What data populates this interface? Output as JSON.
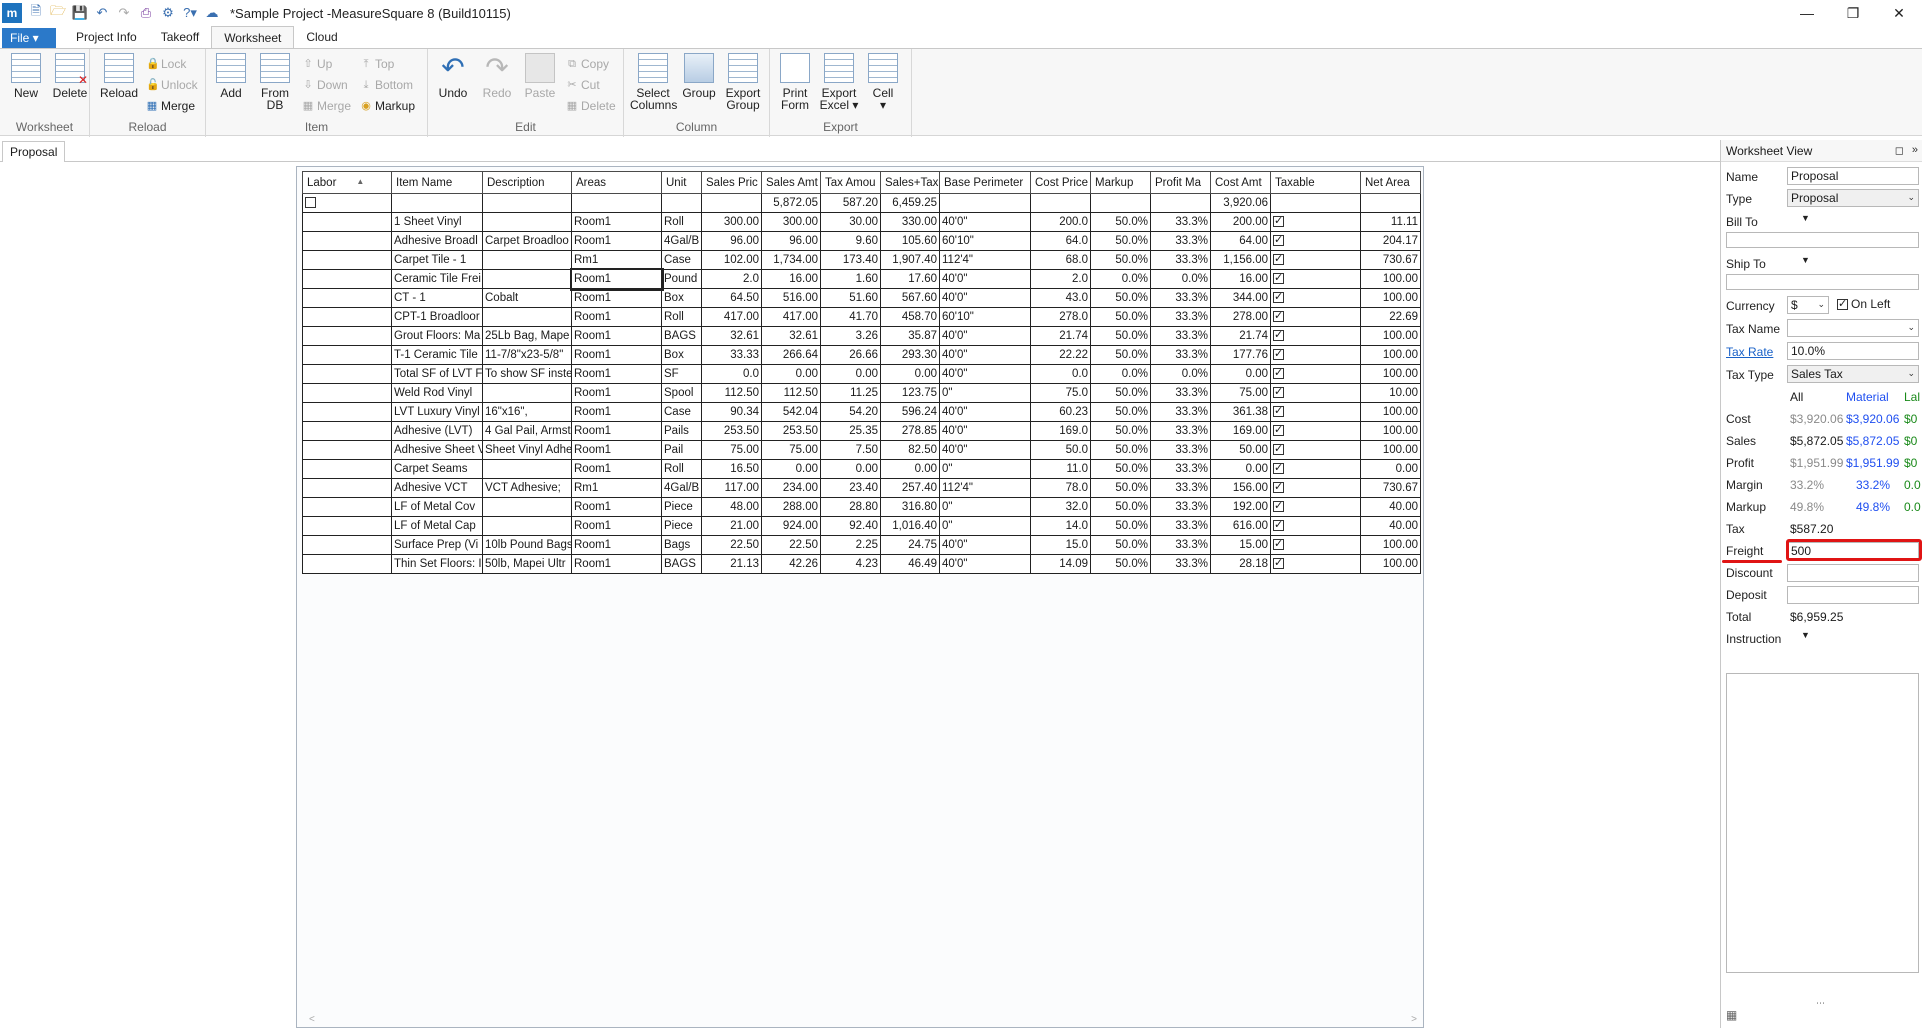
{
  "window": {
    "title": "*Sample Project -MeasureSquare 8 (Build10115)",
    "logo": "m"
  },
  "menu": {
    "file": "File",
    "tabs": [
      "Project Info",
      "Takeoff",
      "Worksheet",
      "Cloud"
    ],
    "active_tab": "Worksheet"
  },
  "ribbon": {
    "worksheet_group": {
      "label": "Worksheet",
      "new": "New",
      "delete": "Delete"
    },
    "reload_group": {
      "label": "Reload",
      "reload": "Reload",
      "lock": "Lock",
      "unlock": "Unlock",
      "merge": "Merge"
    },
    "item_group": {
      "label": "Item",
      "add": "Add",
      "from_db_1": "From",
      "from_db_2": "DB",
      "up": "Up",
      "down": "Down",
      "merge": "Merge",
      "top": "Top",
      "bottom": "Bottom",
      "markup": "Markup"
    },
    "edit_group": {
      "label": "Edit",
      "undo": "Undo",
      "redo": "Redo",
      "paste": "Paste",
      "copy": "Copy",
      "cut": "Cut",
      "delete": "Delete"
    },
    "column_group": {
      "label": "Column",
      "select_1": "Select",
      "select_2": "Columns",
      "group": "Group",
      "export_group_1": "Export",
      "export_group_2": "Group"
    },
    "export_group": {
      "label": "Export",
      "print_1": "Print",
      "print_2": "Form",
      "excel_1": "Export",
      "excel_2": "Excel",
      "cell": "Cell"
    }
  },
  "doc_tab": "Proposal",
  "grid": {
    "headers": [
      "Labor",
      "Item Name",
      "Description",
      "Areas",
      "Unit",
      "Sales Pric",
      "Sales Amt",
      "Tax Amou",
      "Sales+Tax",
      "Base Perimeter",
      "Cost Price",
      "Markup",
      "Profit Ma",
      "Cost Amt",
      "Taxable",
      "Net Area"
    ],
    "totals": {
      "sales_amt": "5,872.05",
      "tax_amt": "587.20",
      "sales_tax": "6,459.25",
      "cost_amt": "3,920.06"
    },
    "rows": [
      [
        "",
        "1 Sheet Vinyl",
        "",
        "Room1",
        "Roll",
        "300.00",
        "300.00",
        "30.00",
        "330.00",
        "40'0\"",
        "200.0",
        "50.0%",
        "33.3%",
        "200.00",
        "✓",
        "11.11"
      ],
      [
        "",
        "Adhesive Broadl",
        "Carpet Broadloo",
        "Room1",
        "4Gal/B",
        "96.00",
        "96.00",
        "9.60",
        "105.60",
        "60'10\"",
        "64.0",
        "50.0%",
        "33.3%",
        "64.00",
        "✓",
        "204.17"
      ],
      [
        "",
        "Carpet Tile - 1",
        "",
        "Rm1",
        "Case",
        "102.00",
        "1,734.00",
        "173.40",
        "1,907.40",
        "112'4\"",
        "68.0",
        "50.0%",
        "33.3%",
        "1,156.00",
        "✓",
        "730.67"
      ],
      [
        "",
        "Ceramic Tile Frei",
        "",
        "Room1",
        "Pound",
        "2.0",
        "16.00",
        "1.60",
        "17.60",
        "40'0\"",
        "2.0",
        "0.0%",
        "0.0%",
        "16.00",
        "✓",
        "100.00"
      ],
      [
        "",
        "CT - 1",
        "Cobalt",
        "Room1",
        "Box",
        "64.50",
        "516.00",
        "51.60",
        "567.60",
        "40'0\"",
        "43.0",
        "50.0%",
        "33.3%",
        "344.00",
        "✓",
        "100.00"
      ],
      [
        "",
        "CPT-1 Broadloor",
        "",
        "Room1",
        "Roll",
        "417.00",
        "417.00",
        "41.70",
        "458.70",
        "60'10\"",
        "278.0",
        "50.0%",
        "33.3%",
        "278.00",
        "✓",
        "22.69"
      ],
      [
        "",
        "Grout Floors: Ma",
        "25Lb Bag, Mape",
        "Room1",
        "BAGS",
        "32.61",
        "32.61",
        "3.26",
        "35.87",
        "40'0\"",
        "21.74",
        "50.0%",
        "33.3%",
        "21.74",
        "✓",
        "100.00"
      ],
      [
        "",
        "T-1 Ceramic Tile",
        "11-7/8\"x23-5/8\"",
        "Room1",
        "Box",
        "33.33",
        "266.64",
        "26.66",
        "293.30",
        "40'0\"",
        "22.22",
        "50.0%",
        "33.3%",
        "177.76",
        "✓",
        "100.00"
      ],
      [
        "",
        "Total SF of LVT F",
        "To show SF inste",
        "Room1",
        "SF",
        "0.0",
        "0.00",
        "0.00",
        "0.00",
        "40'0\"",
        "0.0",
        "0.0%",
        "0.0%",
        "0.00",
        "✓",
        "100.00"
      ],
      [
        "",
        "Weld Rod Vinyl",
        "",
        "Room1",
        "Spool",
        "112.50",
        "112.50",
        "11.25",
        "123.75",
        "0\"",
        "75.0",
        "50.0%",
        "33.3%",
        "75.00",
        "✓",
        "10.00"
      ],
      [
        "",
        "LVT Luxury Vinyl",
        "16\"x16\",",
        "Room1",
        "Case",
        "90.34",
        "542.04",
        "54.20",
        "596.24",
        "40'0\"",
        "60.23",
        "50.0%",
        "33.3%",
        "361.38",
        "✓",
        "100.00"
      ],
      [
        "",
        "Adhesive (LVT)",
        "4 Gal Pail, Armst",
        "Room1",
        "Pails",
        "253.50",
        "253.50",
        "25.35",
        "278.85",
        "40'0\"",
        "169.0",
        "50.0%",
        "33.3%",
        "169.00",
        "✓",
        "100.00"
      ],
      [
        "",
        "Adhesive Sheet V",
        "Sheet Vinyl Adhe",
        "Room1",
        "Pail",
        "75.00",
        "75.00",
        "7.50",
        "82.50",
        "40'0\"",
        "50.0",
        "50.0%",
        "33.3%",
        "50.00",
        "✓",
        "100.00"
      ],
      [
        "",
        "Carpet Seams",
        "",
        "Room1",
        "Roll",
        "16.50",
        "0.00",
        "0.00",
        "0.00",
        "0\"",
        "11.0",
        "50.0%",
        "33.3%",
        "0.00",
        "✓",
        "0.00"
      ],
      [
        "",
        "Adhesive VCT",
        "VCT Adhesive;",
        "Rm1",
        "4Gal/B",
        "117.00",
        "234.00",
        "23.40",
        "257.40",
        "112'4\"",
        "78.0",
        "50.0%",
        "33.3%",
        "156.00",
        "✓",
        "730.67"
      ],
      [
        "",
        "LF  of Metal Cov",
        "",
        "Room1",
        "Piece",
        "48.00",
        "288.00",
        "28.80",
        "316.80",
        "0\"",
        "32.0",
        "50.0%",
        "33.3%",
        "192.00",
        "✓",
        "40.00"
      ],
      [
        "",
        "LF of Metal Cap",
        "",
        "Room1",
        "Piece",
        "21.00",
        "924.00",
        "92.40",
        "1,016.40",
        "0\"",
        "14.0",
        "50.0%",
        "33.3%",
        "616.00",
        "✓",
        "40.00"
      ],
      [
        "",
        "Surface Prep (Vi",
        "10lb Pound Bags",
        "Room1",
        "Bags",
        "22.50",
        "22.50",
        "2.25",
        "24.75",
        "40'0\"",
        "15.0",
        "50.0%",
        "33.3%",
        "15.00",
        "✓",
        "100.00"
      ],
      [
        "",
        "Thin Set Floors: I",
        "50lb, Mapei Ultr",
        "Room1",
        "BAGS",
        "21.13",
        "42.26",
        "4.23",
        "46.49",
        "40'0\"",
        "14.09",
        "50.0%",
        "33.3%",
        "28.18",
        "✓",
        "100.00"
      ]
    ]
  },
  "panel": {
    "title": "Worksheet View",
    "name_label": "Name",
    "name_value": "Proposal",
    "type_label": "Type",
    "type_value": "Proposal",
    "bill_to_label": "Bill To",
    "ship_to_label": "Ship To",
    "currency_label": "Currency",
    "currency_value": "$",
    "on_left": "On Left",
    "tax_name_label": "Tax Name",
    "tax_rate_label": "Tax Rate",
    "tax_rate_value": "10.0%",
    "tax_type_label": "Tax Type",
    "tax_type_value": "Sales Tax",
    "col_all": "All",
    "col_material": "Material",
    "col_labor": "Lal",
    "cost_label": "Cost",
    "cost_all": "$3,920.06",
    "cost_material": "$3,920.06",
    "cost_labor": "$0",
    "sales_label": "Sales",
    "sales_all": "$5,872.05",
    "sales_material": "$5,872.05",
    "sales_labor": "$0",
    "profit_label": "Profit",
    "profit_all": "$1,951.99",
    "profit_material": "$1,951.99",
    "profit_labor": "$0",
    "margin_label": "Margin",
    "margin_all": "33.2%",
    "margin_material": "33.2%",
    "margin_labor": "0.0",
    "markup_label": "Markup",
    "markup_all": "49.8%",
    "markup_material": "49.8%",
    "markup_labor": "0.0",
    "tax_label": "Tax",
    "tax_value": "$587.20",
    "freight_label": "Freight",
    "freight_value": "500",
    "discount_label": "Discount",
    "deposit_label": "Deposit",
    "total_label": "Total",
    "total_value": "$6,959.25",
    "instruction_label": "Instruction"
  },
  "colors": {
    "accent": "#2b79c9",
    "highlight": "#e01414",
    "link": "#1a62c8",
    "material": "#1f4ff0",
    "labor": "#1a8a1a"
  }
}
